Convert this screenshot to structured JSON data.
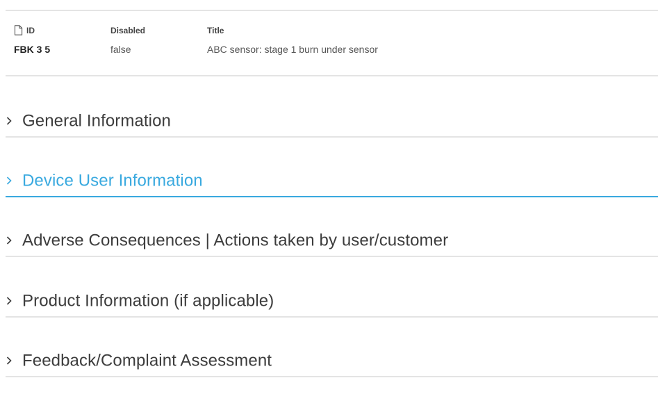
{
  "record": {
    "columns": [
      {
        "label": "ID",
        "value": "FBK 3 5",
        "icon": "document-icon"
      },
      {
        "label": "Disabled",
        "value": "false"
      },
      {
        "label": "Title",
        "value": "ABC sensor: stage 1 burn under sensor"
      }
    ]
  },
  "sections": [
    {
      "title": "General Information",
      "expanded": false,
      "active": false
    },
    {
      "title": "Device User Information",
      "expanded": false,
      "active": true
    },
    {
      "title": "Adverse Consequences | Actions taken by user/customer",
      "expanded": false,
      "active": false
    },
    {
      "title": "Product Information (if applicable)",
      "expanded": false,
      "active": false
    },
    {
      "title": "Feedback/Complaint Assessment",
      "expanded": false,
      "active": false
    }
  ],
  "colors": {
    "accent": "#39a9df",
    "divider": "#e4e4e4",
    "heading": "#3c3c3c"
  }
}
